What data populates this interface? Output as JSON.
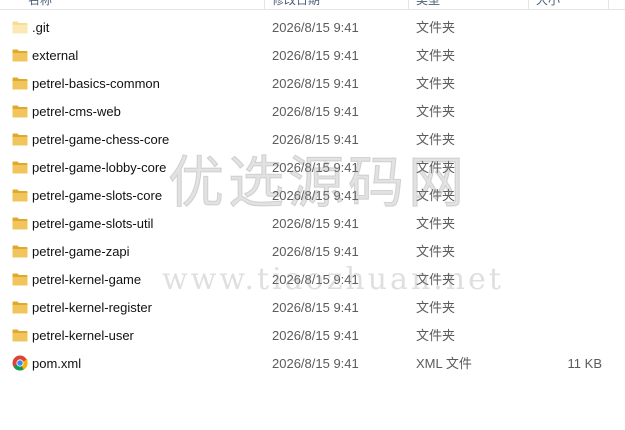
{
  "header": {
    "columns": [
      {
        "label": "名称"
      },
      {
        "label": "修改日期"
      },
      {
        "label": "类型"
      },
      {
        "label": "大小"
      }
    ]
  },
  "files": [
    {
      "name": ".git",
      "date": "2026/8/15 9:41",
      "type": "文件夹",
      "size": "",
      "icon": "folder-icon-light"
    },
    {
      "name": "external",
      "date": "2026/8/15 9:41",
      "type": "文件夹",
      "size": "",
      "icon": "folder-icon"
    },
    {
      "name": "petrel-basics-common",
      "date": "2026/8/15 9:41",
      "type": "文件夹",
      "size": "",
      "icon": "folder-icon"
    },
    {
      "name": "petrel-cms-web",
      "date": "2026/8/15 9:41",
      "type": "文件夹",
      "size": "",
      "icon": "folder-icon"
    },
    {
      "name": "petrel-game-chess-core",
      "date": "2026/8/15 9:41",
      "type": "文件夹",
      "size": "",
      "icon": "folder-icon"
    },
    {
      "name": "petrel-game-lobby-core",
      "date": "2026/8/15 9:41",
      "type": "文件夹",
      "size": "",
      "icon": "folder-icon"
    },
    {
      "name": "petrel-game-slots-core",
      "date": "2026/8/15 9:41",
      "type": "文件夹",
      "size": "",
      "icon": "folder-icon"
    },
    {
      "name": "petrel-game-slots-util",
      "date": "2026/8/15 9:41",
      "type": "文件夹",
      "size": "",
      "icon": "folder-icon"
    },
    {
      "name": "petrel-game-zapi",
      "date": "2026/8/15 9:41",
      "type": "文件夹",
      "size": "",
      "icon": "folder-icon"
    },
    {
      "name": "petrel-kernel-game",
      "date": "2026/8/15 9:41",
      "type": "文件夹",
      "size": "",
      "icon": "folder-icon"
    },
    {
      "name": "petrel-kernel-register",
      "date": "2026/8/15 9:41",
      "type": "文件夹",
      "size": "",
      "icon": "folder-icon"
    },
    {
      "name": "petrel-kernel-user",
      "date": "2026/8/15 9:41",
      "type": "文件夹",
      "size": "",
      "icon": "folder-icon"
    },
    {
      "name": "pom.xml",
      "date": "2026/8/15 9:41",
      "type": "XML 文件",
      "size": "11 KB",
      "icon": "chrome-icon"
    }
  ],
  "watermark": {
    "text_cn": "优选源码网",
    "text_url": "www.tiaozhuan.net"
  },
  "colors": {
    "folder": "#f2c55c",
    "folder_dark": "#e0a92e",
    "hover": "#e5f3ff"
  }
}
